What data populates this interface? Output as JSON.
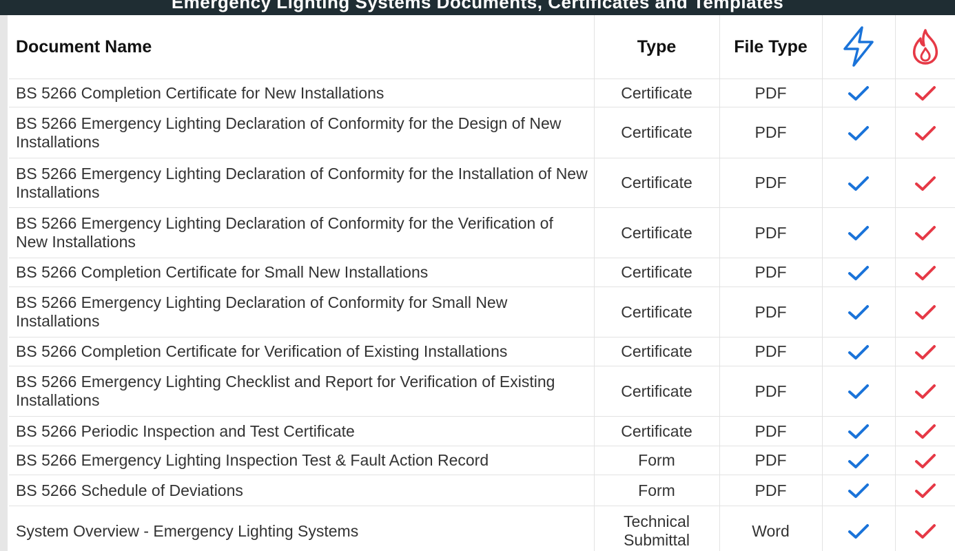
{
  "banner": {
    "title": "Emergency Lighting Systems Documents, Certificates and Templates"
  },
  "table": {
    "headers": {
      "name": "Document Name",
      "type": "Type",
      "file_type": "File Type",
      "electrical_icon": "lightning-bolt-icon",
      "fire_icon": "flame-icon"
    },
    "rows": [
      {
        "name": "BS 5266 Completion Certificate for New Installations",
        "type": "Certificate",
        "file_type": "PDF",
        "electrical": true,
        "fire": true
      },
      {
        "name": "BS 5266 Emergency Lighting Declaration of Conformity for the Design of New Installations",
        "type": "Certificate",
        "file_type": "PDF",
        "electrical": true,
        "fire": true
      },
      {
        "name": "BS 5266 Emergency Lighting Declaration of Conformity for the Installation of New Installations",
        "type": "Certificate",
        "file_type": "PDF",
        "electrical": true,
        "fire": true
      },
      {
        "name": "BS 5266 Emergency Lighting Declaration of Conformity for the Verification of New Installations",
        "type": "Certificate",
        "file_type": "PDF",
        "electrical": true,
        "fire": true
      },
      {
        "name": "BS 5266 Completion Certificate for Small New Installations",
        "type": "Certificate",
        "file_type": "PDF",
        "electrical": true,
        "fire": true
      },
      {
        "name": "BS 5266 Emergency Lighting Declaration of Conformity for Small New Installations",
        "type": "Certificate",
        "file_type": "PDF",
        "electrical": true,
        "fire": true
      },
      {
        "name": "BS 5266 Completion Certificate for Verification of Existing Installations",
        "type": "Certificate",
        "file_type": "PDF",
        "electrical": true,
        "fire": true
      },
      {
        "name": "BS 5266 Emergency Lighting Checklist and Report for Verification of Existing Installations",
        "type": "Certificate",
        "file_type": "PDF",
        "electrical": true,
        "fire": true
      },
      {
        "name": "BS 5266 Periodic Inspection and Test Certificate",
        "type": "Certificate",
        "file_type": "PDF",
        "electrical": true,
        "fire": true
      },
      {
        "name": "BS 5266 Emergency Lighting Inspection Test & Fault Action Record",
        "type": "Form",
        "file_type": "PDF",
        "electrical": true,
        "fire": true
      },
      {
        "name": "BS 5266 Schedule of Deviations",
        "type": "Form",
        "file_type": "PDF",
        "electrical": true,
        "fire": true
      },
      {
        "name": "System Overview - Emergency Lighting Systems",
        "type": "Technical Submittal",
        "file_type": "Word",
        "electrical": true,
        "fire": true
      }
    ]
  },
  "colors": {
    "banner_bg": "#1f2d33",
    "electrical_blue": "#1a73d9",
    "fire_red": "#e63946",
    "grid_line": "#e2e2e2"
  }
}
